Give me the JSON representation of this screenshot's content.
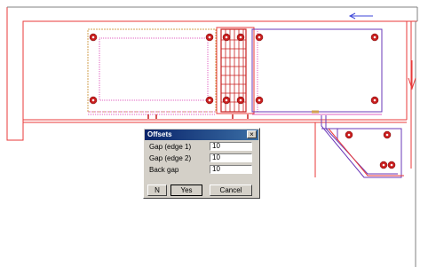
{
  "dialog": {
    "title": "Offsets",
    "close_glyph": "×",
    "fields": [
      {
        "label": "Gap (edge 1)",
        "value": "10"
      },
      {
        "label": "Gap (edge 2)",
        "value": "10"
      },
      {
        "label": "Back gap",
        "value": "10"
      }
    ],
    "buttons": {
      "n": "N",
      "yes": "Yes",
      "cancel": "Cancel"
    }
  },
  "colors": {
    "wall_line": "#e83a3a",
    "cabinet_dotted": "#e060c0",
    "appliance_line": "#6a38b8",
    "knob_fill": "#c81e1e",
    "arrow": "#3c46d8",
    "dialog_bg": "#d4d0c8",
    "title_bar": "#0a246a"
  },
  "icons": [
    "burner-knob-icon",
    "direction-arrow-icon",
    "close-icon"
  ]
}
